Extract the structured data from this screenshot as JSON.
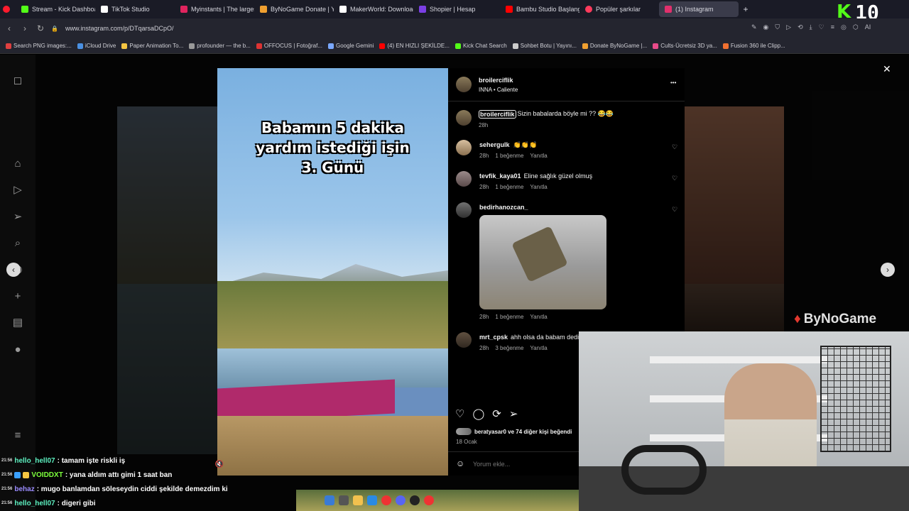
{
  "browser": {
    "tabs": [
      {
        "title": "Stream - Kick Dashboard",
        "color": "#53fc18"
      },
      {
        "title": "TikTok Studio",
        "color": "#ffffff"
      },
      {
        "title": "Myinstants | The largest in",
        "color": "#e0245e"
      },
      {
        "title": "ByNoGame Donate | Yayın",
        "color": "#f0a030"
      },
      {
        "title": "MakerWorld: Download F",
        "color": "#ffffff"
      },
      {
        "title": "Shopier | Hesap",
        "color": "#7b3fe4"
      },
      {
        "title": "Bambu Studio Başlangıç E",
        "color": "#ff0000"
      },
      {
        "title": "Popüler şarkılar",
        "color": "#ff3b5c"
      },
      {
        "title": "(1) Instagram",
        "color": "#e1306c"
      }
    ],
    "active_tab_index": 8,
    "new_tab_label": "+",
    "url": "www.instagram.com/p/DTqarsaDCpO/",
    "ai_label": "AI",
    "bookmarks": [
      "Search PNG images:...",
      "iCloud Drive",
      "Paper Animation To...",
      "profounder — the b...",
      "OFFOCUS | Fotoğraf...",
      "Google Gemini",
      "(4) EN HIZLI ŞEKİLDE...",
      "Kick Chat Search",
      "Sohbet Botu | Yayını...",
      "Donate ByNoGame |...",
      "Cults·Ücretsiz 3D ya...",
      "Fusion 360 ile Clipp..."
    ],
    "colors": {
      "tabbar": "#1a1b26",
      "toolbar": "#24252f"
    }
  },
  "overlay": {
    "kick_number": "10",
    "kick_letter": "K",
    "bynogame_label": "ByNoGame"
  },
  "post": {
    "caption_lines": [
      "Babamın 5 dakika",
      "yardım istediği işin",
      "3. Günü"
    ],
    "author": "broilerciflik",
    "audio": "INNA • Caliente",
    "more_label": "•••",
    "author_comment": "Sizin babalarda böyle mi ?? 😂😂",
    "author_comment_time": "28h",
    "comments": [
      {
        "user": "sehergulk",
        "text": "👏👏👏",
        "time": "28h",
        "likes": "1 beğenme",
        "reply": "Yanıtla"
      },
      {
        "user": "tevfik_kaya01",
        "text": "Eline sağlık güzel olmuş",
        "time": "28h",
        "likes": "1 beğenme",
        "reply": "Yanıtla"
      },
      {
        "user": "bedirhanozcan_",
        "text": "",
        "time": "28h",
        "likes": "1 beğenme",
        "reply": "Yanıtla"
      },
      {
        "user": "mrt_cpsk",
        "text": "ahh olsa da babam dedi",
        "time": "28h",
        "likes": "3 beğenme",
        "reply": "Yanıtla"
      }
    ],
    "liked_by": "beratyasar0 ve 74 diğer kişi beğendi",
    "date": "18 Ocak",
    "comment_placeholder": "Yorum ekle...",
    "close_label": "✕"
  },
  "chat": [
    {
      "time": "21:56",
      "user": "hello_hell07",
      "text": ": tamam işte riskli iş",
      "color": "#5ef2c2"
    },
    {
      "time": "21:56",
      "user": "VOIDDXT",
      "text": ": yana aldım attı gimi 1 saat ban",
      "color": "#7dff3c"
    },
    {
      "time": "21:56",
      "user": "behaz",
      "text": ": mugo banlamdan söleseydin ciddi şekilde demezdim ki",
      "color": "#9b8cff"
    },
    {
      "time": "21:56",
      "user": "hello_hell07",
      "text": ": digeri gibi",
      "color": "#5ef2c2"
    }
  ]
}
